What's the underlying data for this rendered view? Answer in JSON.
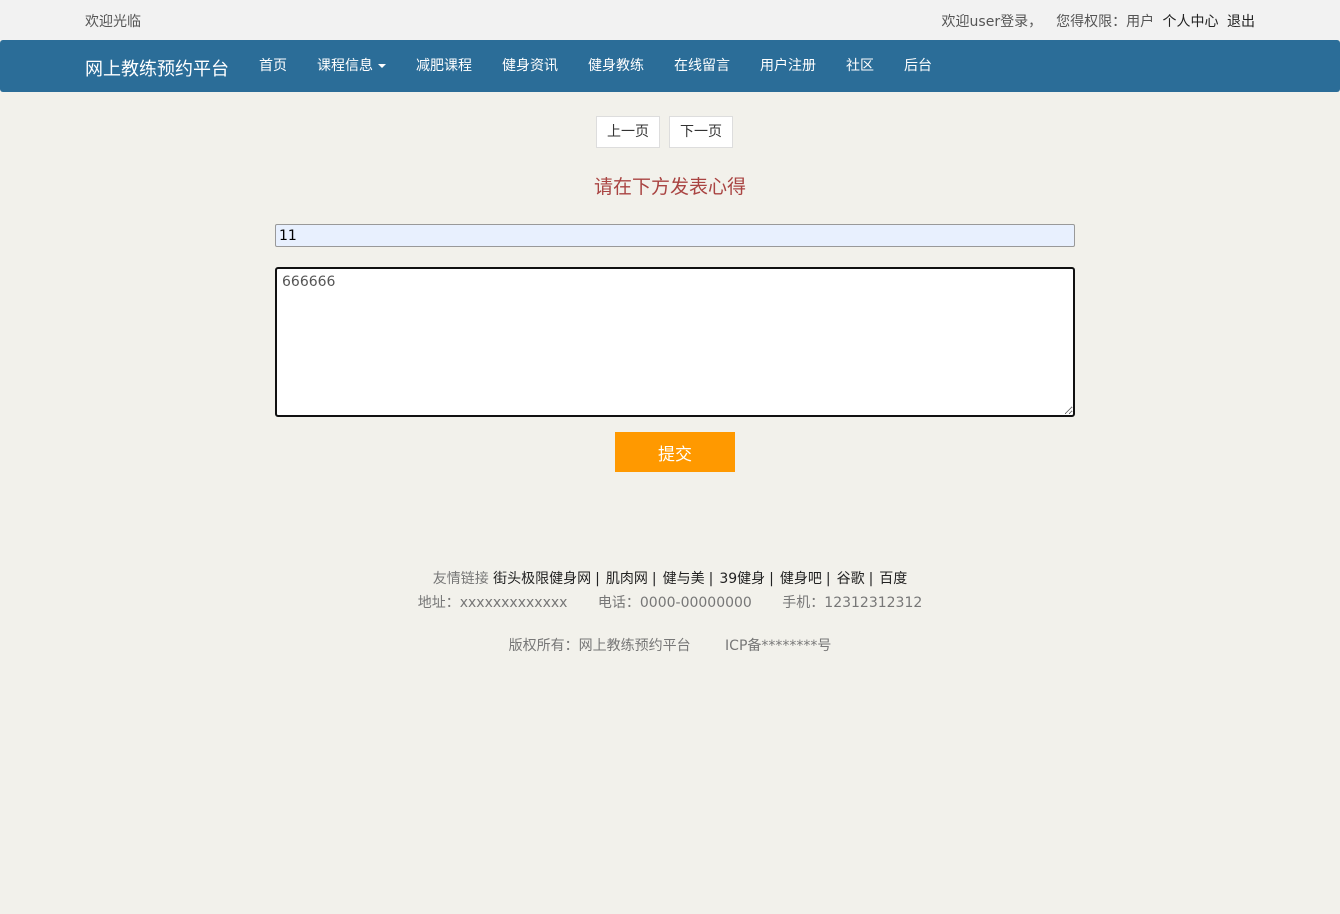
{
  "topbar": {
    "welcome": "欢迎光临",
    "user_greeting": "欢迎user登录，",
    "role_text": "您得权限：用户",
    "profile_link": "个人中心",
    "logout_link": "退出"
  },
  "navbar": {
    "brand": "网上教练预约平台",
    "items": [
      "首页",
      "课程信息",
      "减肥课程",
      "健身资讯",
      "健身教练",
      "在线留言",
      "用户注册",
      "社区",
      "后台"
    ]
  },
  "pager": {
    "prev": "上一页",
    "next": "下一页"
  },
  "form": {
    "prompt": "请在下方发表心得",
    "title_value": "11",
    "content_value": "666666",
    "submit_label": "提交"
  },
  "footer": {
    "links_label": "友情链接",
    "links": [
      "街头极限健身网",
      "肌肉网",
      "健与美",
      "39健身",
      "健身吧",
      "谷歌",
      "百度"
    ],
    "separator": "|",
    "address": "地址：xxxxxxxxxxxxx",
    "phone": "电话：0000-00000000",
    "mobile": "手机：12312312312",
    "copyright": "版权所有：网上教练预约平台",
    "icp": "ICP备********号"
  },
  "colors": {
    "navbar_bg": "#2b6d98",
    "accent_button": "#ff9900",
    "prompt_text": "#a94442",
    "page_bg": "#f2f1eb"
  }
}
